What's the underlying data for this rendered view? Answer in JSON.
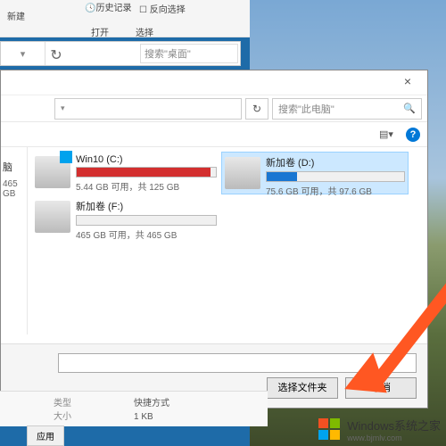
{
  "ribbon": {
    "new": "新建",
    "history": "历史记录",
    "invert": "反向选择",
    "open": "打开",
    "select": "选择"
  },
  "parent_addr": {
    "search_placeholder": "搜索\"桌面\""
  },
  "dialog": {
    "search_placeholder": "搜索\"此电脑\"",
    "close": "×",
    "refresh": "↻",
    "dropdown": "▾",
    "search_icon": "🔍",
    "help": "?",
    "select_btn": "选择文件夹",
    "cancel_btn": "取消"
  },
  "sidebar": {
    "computer": "脑",
    "free_label": "465 GB"
  },
  "drives": [
    {
      "name": "Win10 (C:)",
      "stats": "5.44 GB 可用，共 125 GB",
      "fill": 96,
      "color": "#d32f2f",
      "selected": false,
      "os": true
    },
    {
      "name": "新加卷 (D:)",
      "stats": "75.6 GB 可用，共 97.6 GB",
      "fill": 22,
      "color": "#1976d2",
      "selected": true,
      "os": false
    },
    {
      "name": "新加卷 (F:)",
      "stats": "465 GB 可用，共 465 GB",
      "fill": 0,
      "color": "#1976d2",
      "selected": false,
      "os": false
    }
  ],
  "details": {
    "type_label": "类型",
    "type_value": "快捷方式",
    "size_label": "大小",
    "size_value": "1 KB",
    "app_tab": "应用"
  },
  "watermark": {
    "text": "Windows系统之家",
    "url": "www.bjmlv.com"
  }
}
